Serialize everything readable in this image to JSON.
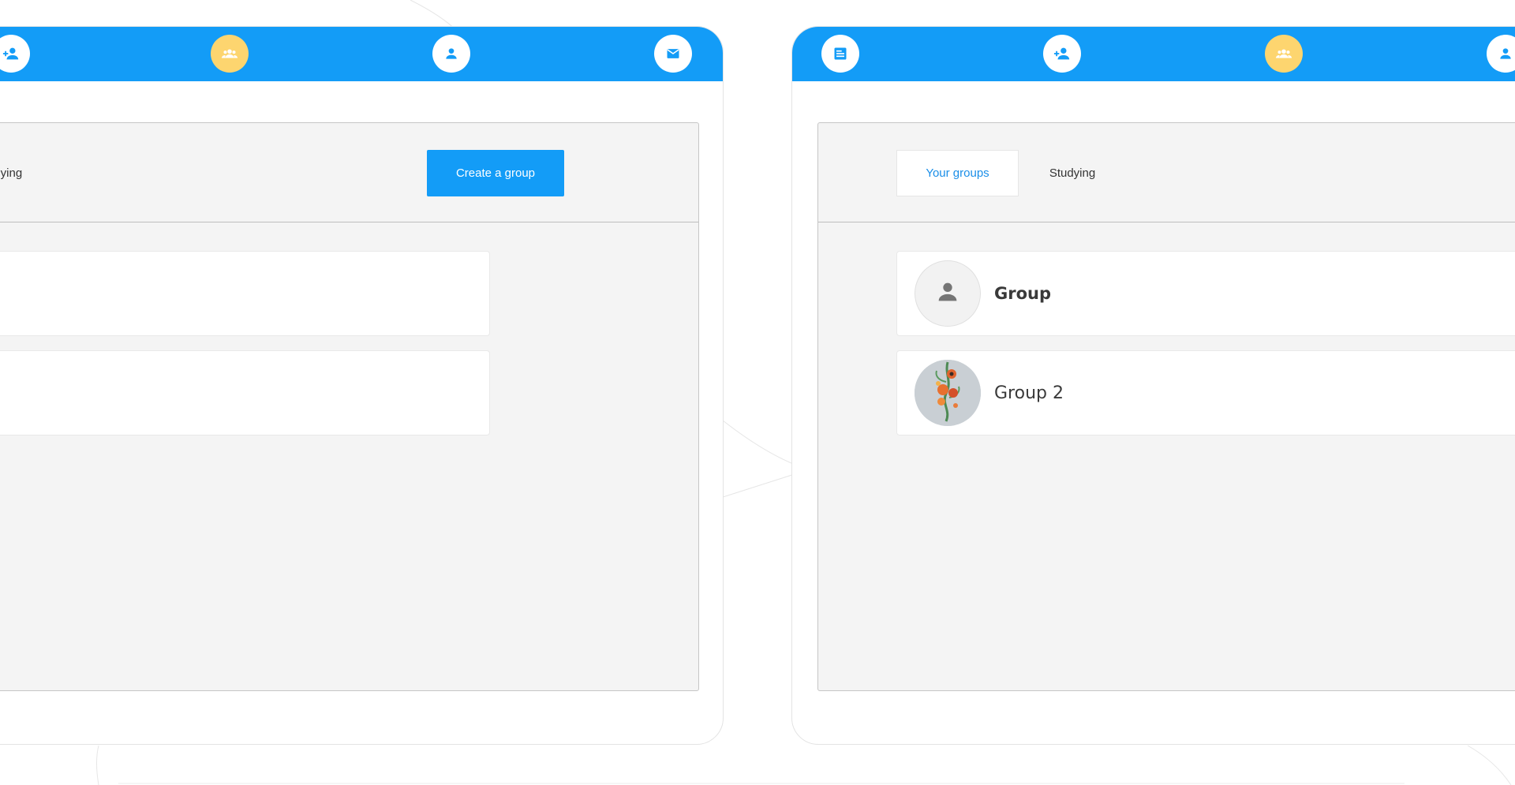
{
  "colors": {
    "primary": "#139cf7",
    "active_nav": "#fdd56f",
    "panel_bg": "#f4f4f4",
    "tab_selected_text": "#1a8ee8"
  },
  "left_screen": {
    "nav": [
      {
        "icon": "add-person-icon",
        "active": false
      },
      {
        "icon": "groups-icon",
        "active": true
      },
      {
        "icon": "person-icon",
        "active": false
      },
      {
        "icon": "mail-icon",
        "active": false
      }
    ],
    "tabs": [
      {
        "label": "Studying",
        "selected": false
      }
    ],
    "create_button_label": "Create a group",
    "group_cards": [
      {
        "name": ""
      },
      {
        "name": ""
      }
    ]
  },
  "right_screen": {
    "nav": [
      {
        "icon": "feed-icon",
        "active": false
      },
      {
        "icon": "add-person-icon",
        "active": false
      },
      {
        "icon": "groups-icon",
        "active": true
      },
      {
        "icon": "person-icon",
        "active": false
      }
    ],
    "tabs": [
      {
        "label": "Your groups",
        "selected": true
      },
      {
        "label": "Studying",
        "selected": false
      }
    ],
    "groups": [
      {
        "name": "Group",
        "avatar": "person-placeholder-icon"
      },
      {
        "name": "Group 2",
        "avatar": "flower-photo"
      }
    ]
  }
}
